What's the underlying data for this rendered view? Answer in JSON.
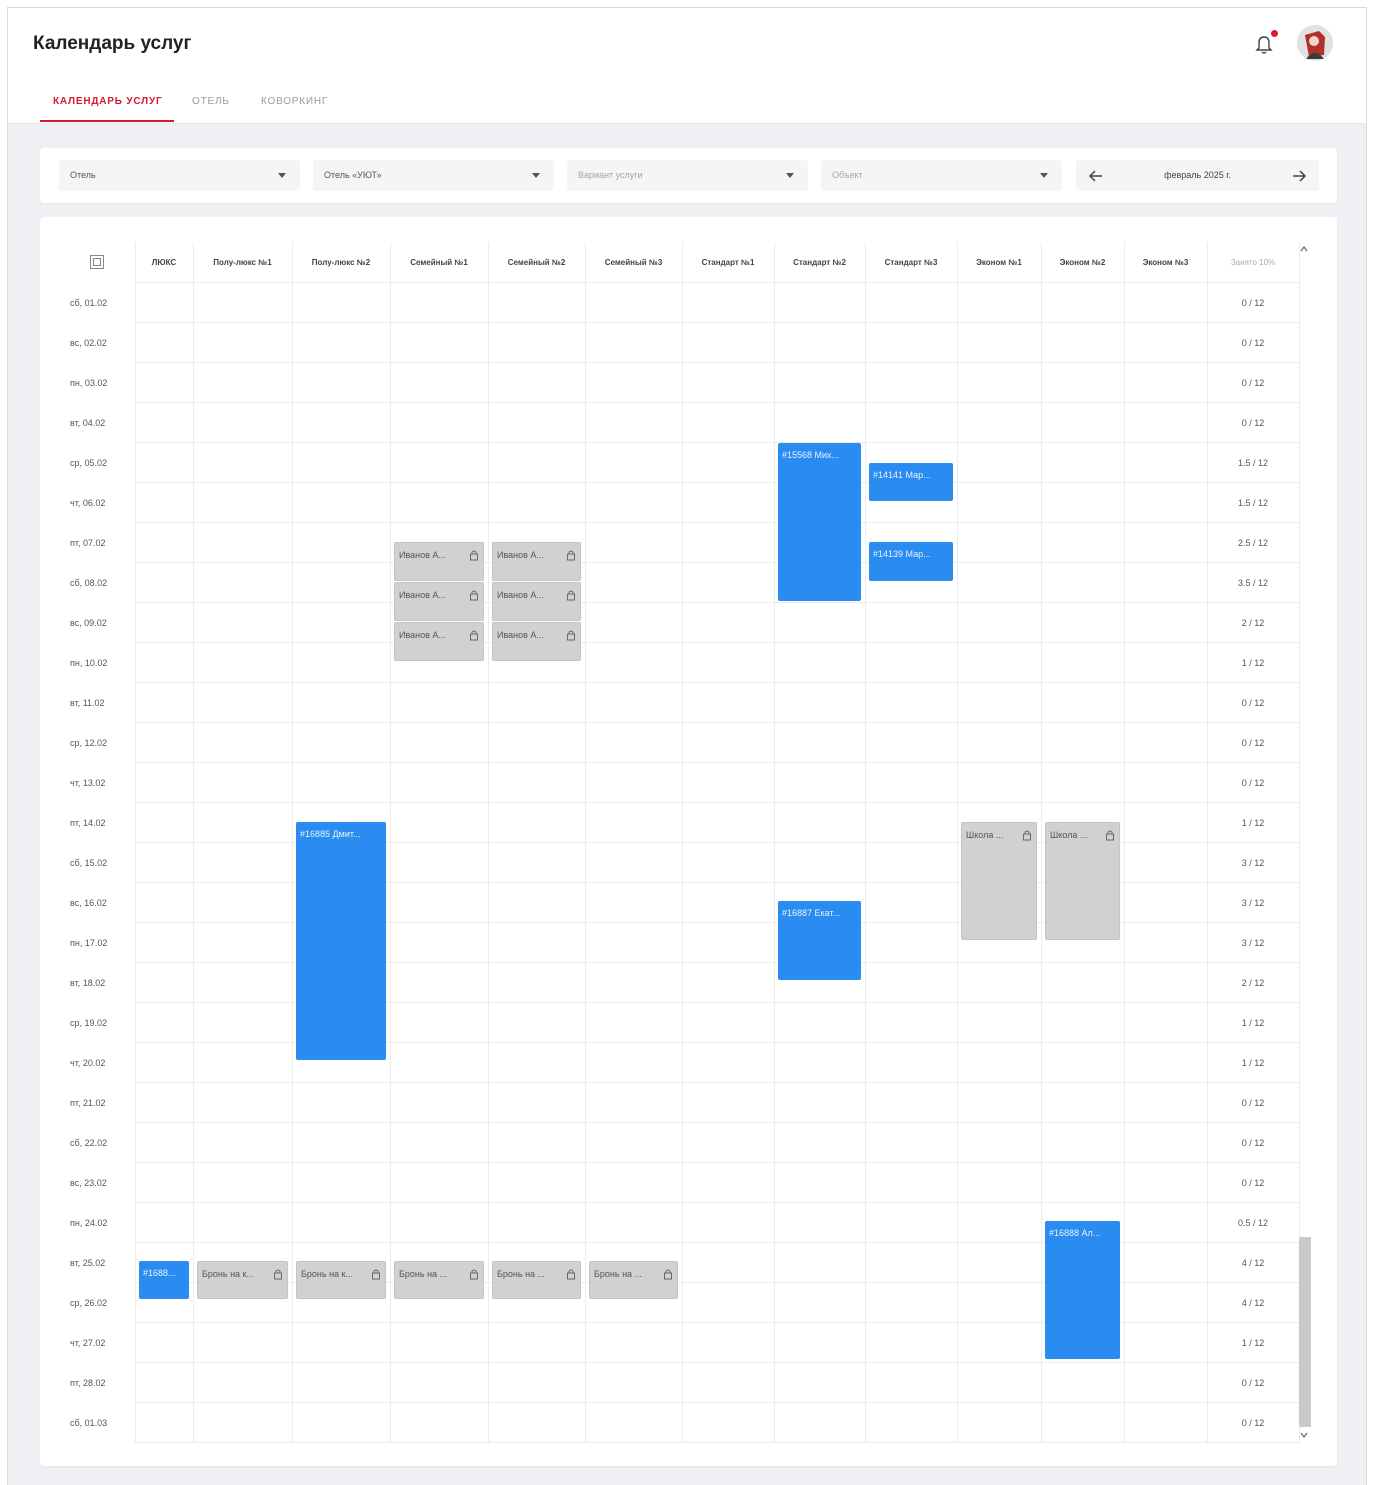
{
  "header": {
    "title": "Календарь услуг"
  },
  "tabs": [
    {
      "label": "КАЛЕНДАРЬ УСЛУГ",
      "active": true
    },
    {
      "label": "ОТЕЛЬ",
      "active": false
    },
    {
      "label": "КОВОРКИНГ",
      "active": false
    }
  ],
  "filters": {
    "type": {
      "value": "Отель"
    },
    "hotel": {
      "value": "Отель «УЮТ»"
    },
    "variant": {
      "placeholder": "Вариант услуги"
    },
    "object": {
      "placeholder": "Объект"
    },
    "month": {
      "label": "февраль 2025 г."
    }
  },
  "colors": {
    "accent": "#d8192e",
    "booking_blue": "#2a8cf0",
    "booking_gray": "#d1d1d1"
  },
  "columns": [
    "ЛЮКС",
    "Полу-люкс №1",
    "Полу-люкс №2",
    "Семейный №1",
    "Семейный №2",
    "Семейный №3",
    "Стандарт №1",
    "Стандарт №2",
    "Стандарт №3",
    "Эконом №1",
    "Эконом №2",
    "Эконом №3"
  ],
  "occupancy_header": "Занято 10%",
  "rows": [
    {
      "date": "сб, 01.02",
      "occ": "0 / 12"
    },
    {
      "date": "вс, 02.02",
      "occ": "0 / 12"
    },
    {
      "date": "пн, 03.02",
      "occ": "0 / 12"
    },
    {
      "date": "вт, 04.02",
      "occ": "0 / 12"
    },
    {
      "date": "ср, 05.02",
      "occ": "1.5 / 12"
    },
    {
      "date": "чт, 06.02",
      "occ": "1.5 / 12"
    },
    {
      "date": "пт, 07.02",
      "occ": "2.5 / 12"
    },
    {
      "date": "сб, 08.02",
      "occ": "3.5 / 12"
    },
    {
      "date": "вс, 09.02",
      "occ": "2 / 12"
    },
    {
      "date": "пн, 10.02",
      "occ": "1 / 12"
    },
    {
      "date": "вт, 11.02",
      "occ": "0 / 12"
    },
    {
      "date": "ср, 12.02",
      "occ": "0 / 12"
    },
    {
      "date": "чт, 13.02",
      "occ": "0 / 12"
    },
    {
      "date": "пт, 14.02",
      "occ": "1 / 12"
    },
    {
      "date": "сб, 15.02",
      "occ": "3 / 12"
    },
    {
      "date": "вс, 16.02",
      "occ": "3 / 12"
    },
    {
      "date": "пн, 17.02",
      "occ": "3 / 12"
    },
    {
      "date": "вт, 18.02",
      "occ": "2 / 12"
    },
    {
      "date": "ср, 19.02",
      "occ": "1 / 12"
    },
    {
      "date": "чт, 20.02",
      "occ": "1 / 12"
    },
    {
      "date": "пт, 21.02",
      "occ": "0 / 12"
    },
    {
      "date": "сб, 22.02",
      "occ": "0 / 12"
    },
    {
      "date": "вс, 23.02",
      "occ": "0 / 12"
    },
    {
      "date": "пн, 24.02",
      "occ": "0.5 / 12"
    },
    {
      "date": "вт, 25.02",
      "occ": "4 / 12"
    },
    {
      "date": "ср, 26.02",
      "occ": "4 / 12"
    },
    {
      "date": "чт, 27.02",
      "occ": "1 / 12"
    },
    {
      "date": "пт, 28.02",
      "occ": "0 / 12"
    },
    {
      "date": "сб, 01.03",
      "occ": "0 / 12"
    }
  ],
  "bookings": [
    {
      "col": 7,
      "start": 4,
      "end": 8,
      "label": "#15568 Мих...",
      "style": "blue",
      "locked": false
    },
    {
      "col": 8,
      "start": 4.5,
      "end": 5.5,
      "label": "#14141 Мар...",
      "style": "blue",
      "locked": false
    },
    {
      "col": 8,
      "start": 6.5,
      "end": 7.5,
      "label": "#14139 Мар...",
      "style": "blue",
      "locked": false
    },
    {
      "col": 3,
      "start": 6.5,
      "end": 7.5,
      "label": "Иванов А...",
      "style": "gray",
      "locked": true
    },
    {
      "col": 3,
      "start": 7.5,
      "end": 8.5,
      "label": "Иванов А...",
      "style": "gray",
      "locked": true
    },
    {
      "col": 3,
      "start": 8.5,
      "end": 9.5,
      "label": "Иванов А...",
      "style": "gray",
      "locked": true
    },
    {
      "col": 4,
      "start": 6.5,
      "end": 7.5,
      "label": "Иванов А...",
      "style": "gray",
      "locked": true
    },
    {
      "col": 4,
      "start": 7.5,
      "end": 8.5,
      "label": "Иванов А...",
      "style": "gray",
      "locked": true
    },
    {
      "col": 4,
      "start": 8.5,
      "end": 9.5,
      "label": "Иванов А...",
      "style": "gray",
      "locked": true
    },
    {
      "col": 2,
      "start": 13.5,
      "end": 19.5,
      "label": "#16885 Дмит...",
      "style": "blue",
      "locked": false
    },
    {
      "col": 9,
      "start": 13.5,
      "end": 16.5,
      "label": "Школа ...",
      "style": "gray",
      "locked": true
    },
    {
      "col": 10,
      "start": 13.5,
      "end": 16.5,
      "label": "Школа ...",
      "style": "gray",
      "locked": true
    },
    {
      "col": 7,
      "start": 15.5,
      "end": 17.5,
      "label": "#16887 Екат...",
      "style": "blue",
      "locked": false
    },
    {
      "col": 10,
      "start": 23.5,
      "end": 27,
      "label": "#16888 Ал...",
      "style": "blue",
      "locked": false
    },
    {
      "col": 0,
      "start": 24.5,
      "end": 25.5,
      "label": "#1688...",
      "style": "blue",
      "locked": false
    },
    {
      "col": 1,
      "start": 24.5,
      "end": 25.5,
      "label": "Бронь на к...",
      "style": "gray",
      "locked": true
    },
    {
      "col": 2,
      "start": 24.5,
      "end": 25.5,
      "label": "Бронь на к...",
      "style": "gray",
      "locked": true
    },
    {
      "col": 3,
      "start": 24.5,
      "end": 25.5,
      "label": "Бронь на ...",
      "style": "gray",
      "locked": true
    },
    {
      "col": 4,
      "start": 24.5,
      "end": 25.5,
      "label": "Бронь на ...",
      "style": "gray",
      "locked": true
    },
    {
      "col": 5,
      "start": 24.5,
      "end": 25.5,
      "label": "Бронь на ...",
      "style": "gray",
      "locked": true
    }
  ]
}
